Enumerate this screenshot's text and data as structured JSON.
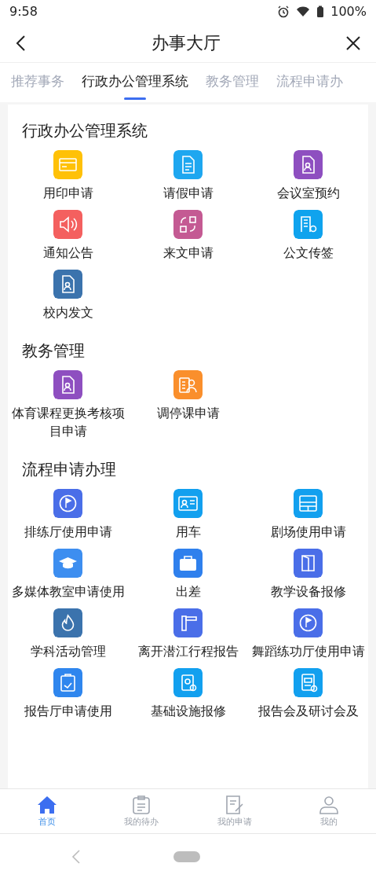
{
  "status_bar": {
    "time": "9:58",
    "battery": "100%"
  },
  "header": {
    "title": "办事大厅"
  },
  "tabs": [
    {
      "label": "推荐事务",
      "selected": false
    },
    {
      "label": "行政办公管理系统",
      "selected": true
    },
    {
      "label": "教务管理",
      "selected": false
    },
    {
      "label": "流程申请办",
      "selected": false
    }
  ],
  "sections": [
    {
      "title": "行政办公管理系统",
      "items": [
        {
          "label": "用印申请",
          "color": "#ffc107"
        },
        {
          "label": "请假申请",
          "color": "#1ea7f0"
        },
        {
          "label": "会议室预约",
          "color": "#8e4fc0"
        },
        {
          "label": "通知公告",
          "color": "#f4605f"
        },
        {
          "label": "来文申请",
          "color": "#c45a93"
        },
        {
          "label": "公文传签",
          "color": "#0fa3ee"
        },
        {
          "label": "校内发文",
          "color": "#3b73ad"
        }
      ]
    },
    {
      "title": "教务管理",
      "items": [
        {
          "label": "体育课程更换考核项目申请",
          "color": "#8e4fc0"
        },
        {
          "label": "调停课申请",
          "color": "#fa8f2c"
        }
      ]
    },
    {
      "title": "流程申请办理",
      "items": [
        {
          "label": "排练厅使用申请",
          "color": "#4a6ee8"
        },
        {
          "label": "用车",
          "color": "#12a0ef"
        },
        {
          "label": "剧场使用申请",
          "color": "#12a0ef"
        },
        {
          "label": "多媒体教室申请使用",
          "color": "#3d8ef0"
        },
        {
          "label": "出差",
          "color": "#2f80ed"
        },
        {
          "label": "教学设备报修",
          "color": "#4a6ee8"
        },
        {
          "label": "学科活动管理",
          "color": "#3b73ad"
        },
        {
          "label": "离开潜江行程报告",
          "color": "#4a6ee8"
        },
        {
          "label": "舞蹈练功厅使用申请",
          "color": "#4a6ee8"
        },
        {
          "label": "报告厅申请使用",
          "color": "#2f86ee"
        },
        {
          "label": "基础设施报修",
          "color": "#12a0ef"
        },
        {
          "label": "报告会及研讨会及",
          "color": "#12a0ef"
        }
      ]
    }
  ],
  "bottom_nav": [
    {
      "label": "首页",
      "selected": true
    },
    {
      "label": "我的待办",
      "selected": false
    },
    {
      "label": "我的申请",
      "selected": false
    },
    {
      "label": "我的",
      "selected": false
    }
  ]
}
